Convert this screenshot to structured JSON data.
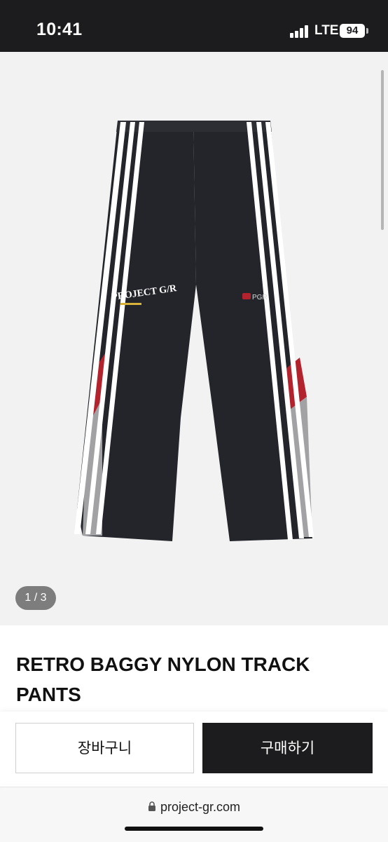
{
  "status_bar": {
    "time": "10:41",
    "network": "LTE",
    "battery": "94"
  },
  "gallery": {
    "page_indicator": "1 / 3",
    "current_page": 1,
    "total_pages": 3
  },
  "product": {
    "title": "RETRO BAGGY NYLON TRACK PANTS",
    "waistband_logo": "PROJECT G/R",
    "leg_logo": "PGR"
  },
  "actions": {
    "cart_label": "장바구니",
    "buy_label": "구매하기"
  },
  "browser": {
    "url": "project-gr.com"
  },
  "colors": {
    "pants": "#23252b",
    "stripe": "#ffffff",
    "accent_red": "#b3232d",
    "panel_gray": "#a2a2a4",
    "buy_button": "#1c1c1e"
  }
}
